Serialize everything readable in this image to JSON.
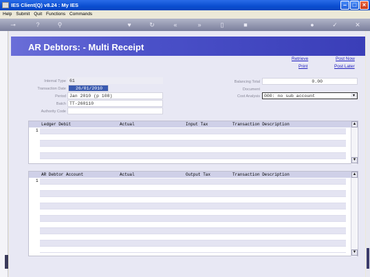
{
  "window": {
    "title": "IES Client(Q) v8.24 : My IES"
  },
  "menu": [
    "Help",
    "Submit",
    "Quit",
    "Functions",
    "Commands"
  ],
  "toolbar_icons": [
    "key-icon",
    "help-icon",
    "search-icon",
    "heart-icon",
    "refresh-icon",
    "rewind-icon",
    "forward-icon",
    "document-icon",
    "stop-icon",
    "globe-icon",
    "check-icon",
    "close-icon"
  ],
  "header": {
    "title": "AR Debtors: - Multi Receipt"
  },
  "links": {
    "retrieve": "Retrieve",
    "print": "Print",
    "post_now": "Post Now",
    "post_later": "Post Later"
  },
  "fields": {
    "internal_type": {
      "label": "Internal Type",
      "value": "61"
    },
    "transaction_date": {
      "label": "Transaction Date",
      "value": "26/01/2010"
    },
    "period": {
      "label": "Period",
      "value": "Jan 2010 (p 108)"
    },
    "batch": {
      "label": "Batch",
      "value": "TT-260110"
    },
    "authority_code": {
      "label": "Authority Code",
      "value": ""
    },
    "balancing_total": {
      "label": "Balancing Total",
      "value": "0.00"
    },
    "document": {
      "label": "Document",
      "value": ""
    },
    "cost_analysis": {
      "label": "Cost Analysis",
      "value": "000: no sub account"
    }
  },
  "grid1": {
    "columns": [
      "Ledger Debit",
      "Actual",
      "Input Tax",
      "Transaction Description"
    ],
    "row_number": "1"
  },
  "grid2": {
    "columns": [
      "AR Debtor Account",
      "Actual",
      "Output Tax",
      "Transaction Description"
    ],
    "row_number": "1"
  }
}
